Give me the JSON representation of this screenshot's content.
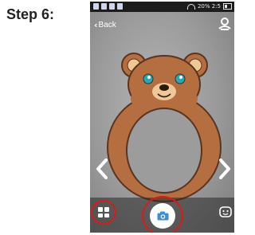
{
  "step": {
    "label": "Step 6:"
  },
  "statusbar": {
    "left_icons": [
      "notification-icon",
      "notification-icon",
      "notification-icon",
      "notification-icon"
    ],
    "right_text": "20% 2:5"
  },
  "nav": {
    "back_label": "Back"
  },
  "overlay": {
    "name": "bear-face-frame",
    "colors": {
      "fur": "#b56e3f",
      "muzzle": "#f0c896",
      "eyes": "#2aa7b0",
      "outline": "#5a3420"
    }
  },
  "controls": {
    "highlight_color": "#d81b1b",
    "icons": [
      "chevron-left-icon",
      "chevron-right-icon",
      "grid-icon",
      "camera-icon",
      "face-icon",
      "switch-camera-icon"
    ]
  }
}
